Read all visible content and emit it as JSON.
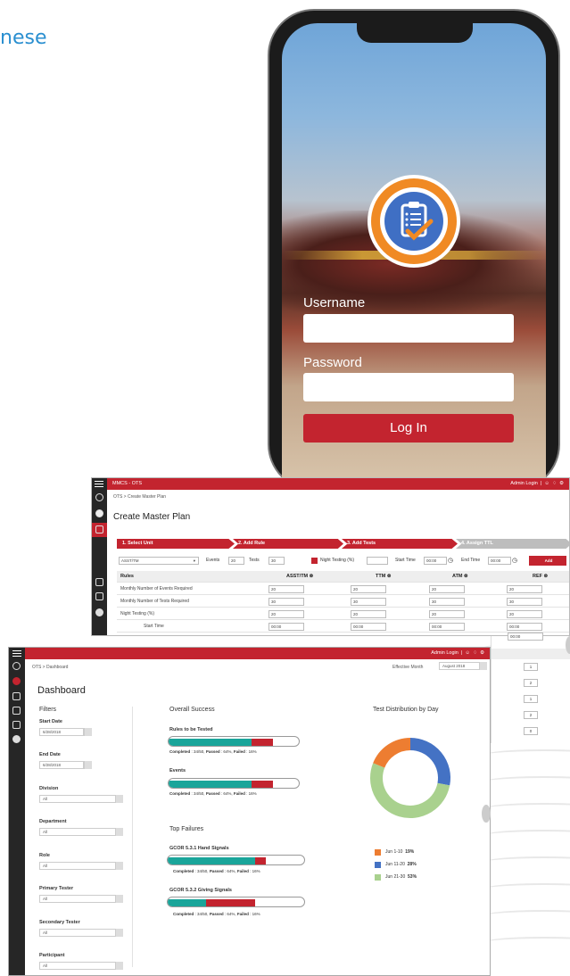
{
  "heading_fragment": "nese",
  "phone": {
    "username_label": "Username",
    "password_label": "Password",
    "login_label": "Log In"
  },
  "master_plan": {
    "app_title": "MMCS - OTS",
    "user": "Admin Login",
    "breadcrumb": "OTS > Create Master Plan",
    "title": "Create Master Plan",
    "steps": [
      "1. Select Unit",
      "2. Add Rule",
      "3. Add Tests",
      "4. Assign TTL"
    ],
    "toolbar": {
      "unit_select": "ASST/TM",
      "events_label": "Events",
      "events_value": "20",
      "tests_label": "Tests",
      "tests_value": "30",
      "night_label": "Night Testing (%)",
      "start_label": "Start Time",
      "start_value": "00:00",
      "end_label": "End Time",
      "end_value": "00:00",
      "add_label": "Add"
    },
    "columns": [
      "Rules",
      "ASST/TM",
      "TTM",
      "ATM",
      "REF"
    ],
    "rows": [
      {
        "label": "Monthly Number of Events Required",
        "values": [
          "20",
          "20",
          "20",
          "20"
        ]
      },
      {
        "label": "Monthly Number of Tests Required",
        "values": [
          "30",
          "30",
          "30",
          "30"
        ]
      },
      {
        "label": "Night Testing (%)",
        "values": [
          "20",
          "20",
          "20",
          "20"
        ]
      },
      {
        "label": "Start Time",
        "values": [
          "00:00",
          "00:00",
          "00:00",
          "00:00"
        ]
      },
      {
        "label": "",
        "values": [
          "",
          "",
          "",
          "00:00"
        ]
      }
    ],
    "ttl_values": [
      "1",
      "2",
      "1",
      "2",
      "0"
    ]
  },
  "dashboard": {
    "breadcrumb": "OTS > Dashboard",
    "effective_label": "Effective Month",
    "effective_value": "August 2018",
    "title": "Dashboard",
    "filters_title": "Filters",
    "filters": [
      {
        "label": "Start Date",
        "value": "6/28/2018",
        "kind": "date"
      },
      {
        "label": "End Date",
        "value": "6/28/2018",
        "kind": "date"
      },
      {
        "label": "Division",
        "value": "All",
        "kind": "select"
      },
      {
        "label": "Department",
        "value": "All",
        "kind": "select"
      },
      {
        "label": "Role",
        "value": "All",
        "kind": "select"
      },
      {
        "label": "Primary Tester",
        "value": "All",
        "kind": "select"
      },
      {
        "label": "Secondary Tester",
        "value": "All",
        "kind": "select"
      },
      {
        "label": "Participant",
        "value": "All",
        "kind": "select"
      }
    ],
    "overall_title": "Overall Success",
    "overall": [
      {
        "label": "Rules to be Tested",
        "passed": 0.64,
        "failed": 0.16
      },
      {
        "label": "Events",
        "passed": 0.64,
        "failed": 0.16
      }
    ],
    "top_failures_title": "Top Failures",
    "failures": [
      {
        "label": "GCOR 5.3.1 Hand Signals",
        "passed": 0.64,
        "failed": 0.08
      },
      {
        "label": "GCOR 5.3.2 Giving Signals",
        "passed": 0.28,
        "failed": 0.36
      }
    ],
    "stats_text": {
      "completed": "Completed",
      "completed_val": ": 34/50,",
      "passed": "Passed",
      "passed_val": ": 64%,",
      "failed": "Failed",
      "failed_val": ": 16%",
      "failed_val_hand": ": 16%"
    },
    "distribution_title": "Test Distribution by Day",
    "distribution": [
      {
        "label": "Jun 1-10",
        "pct": "19%",
        "value": 19,
        "color": "#ed7d31"
      },
      {
        "label": "Jun 11-20",
        "pct": "28%",
        "value": 28,
        "color": "#4472c4"
      },
      {
        "label": "Jun 21-30",
        "pct": "53%",
        "value": 53,
        "color": "#a9d18e"
      }
    ]
  }
}
